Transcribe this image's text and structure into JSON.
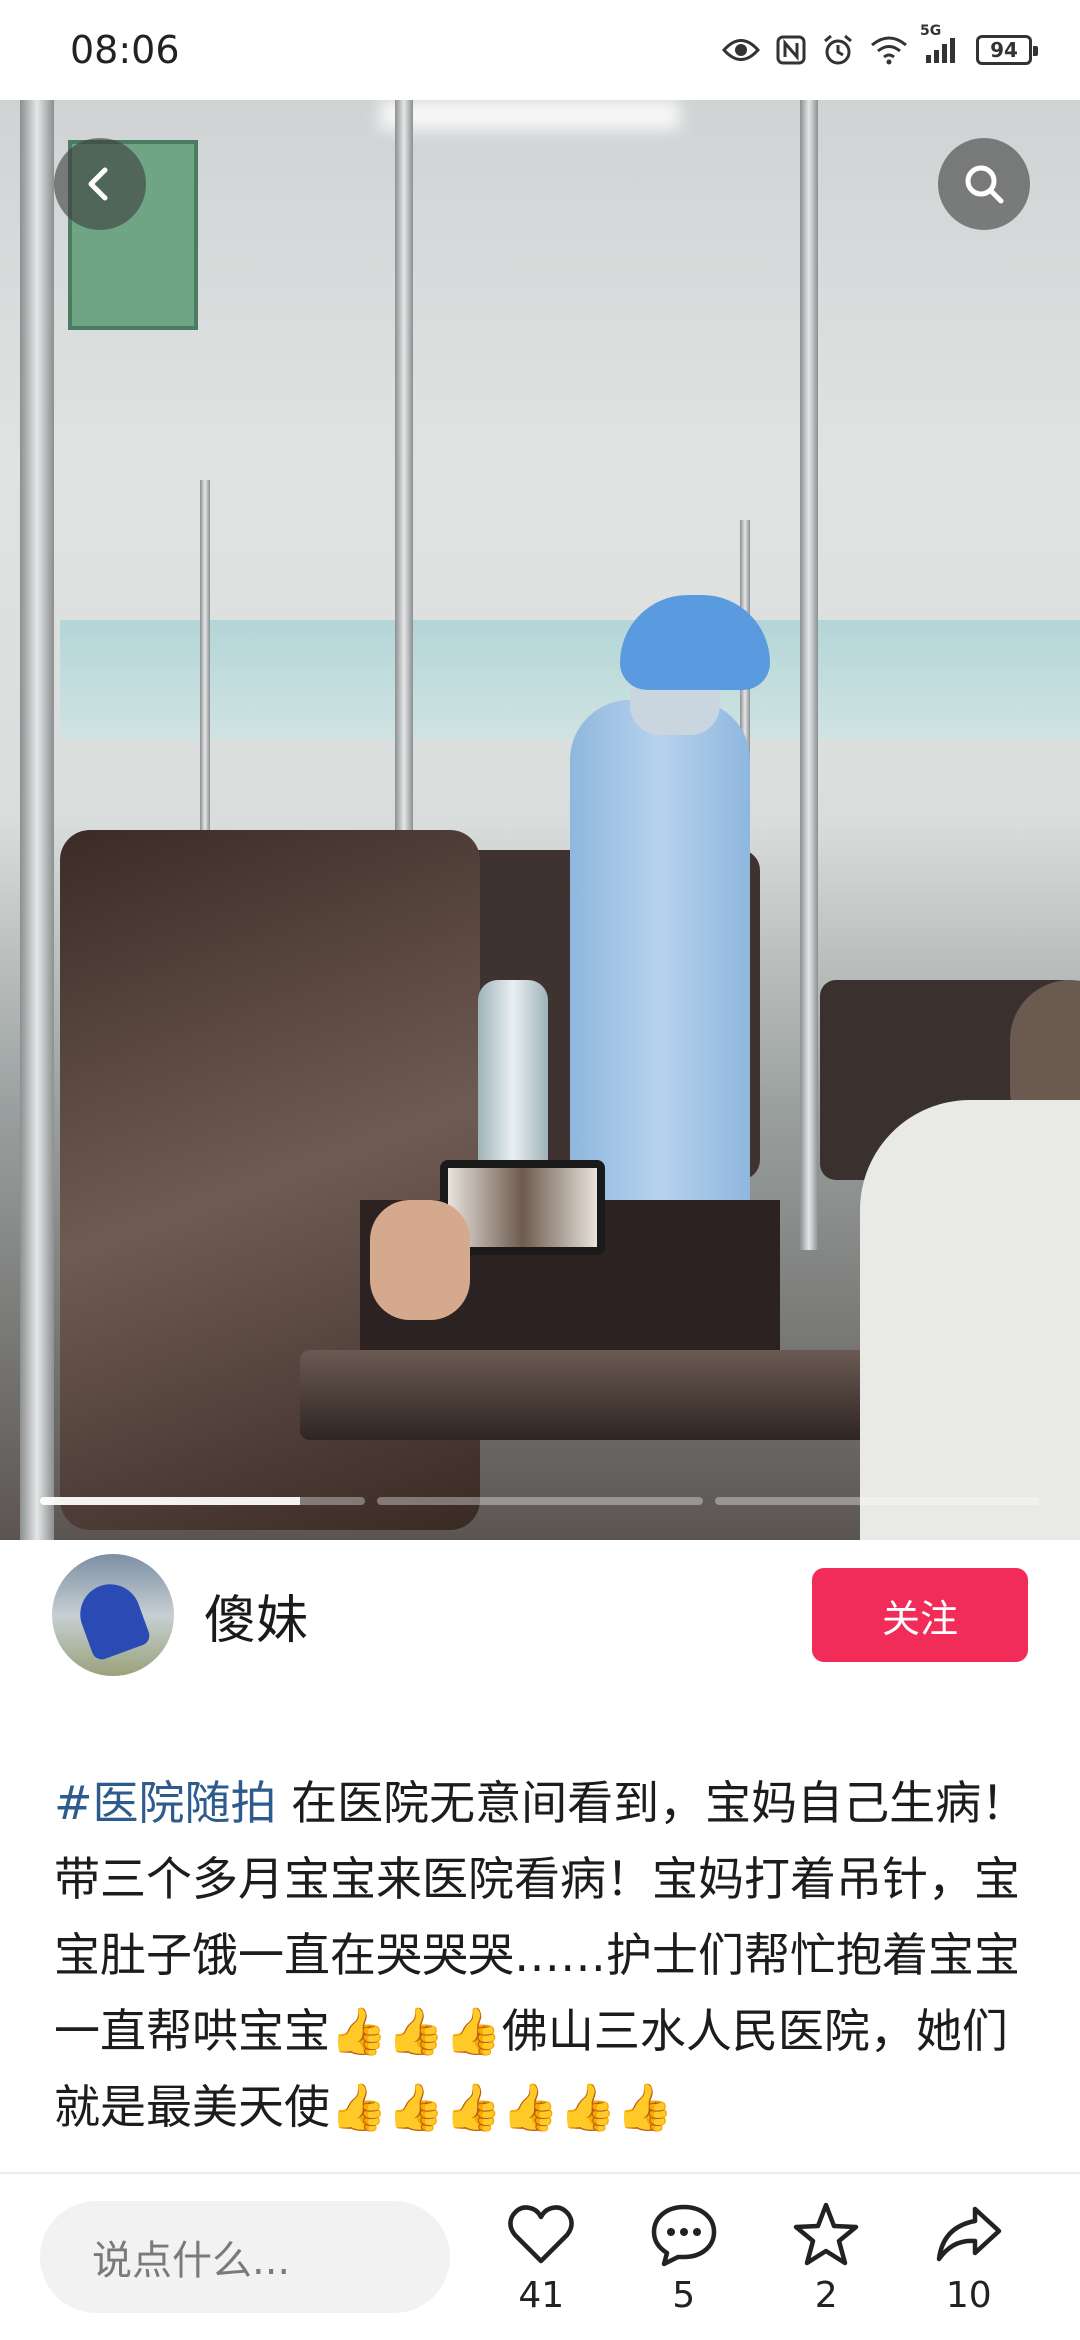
{
  "status_bar": {
    "time": "08:06",
    "icons": [
      "eye-icon",
      "nfc-icon",
      "alarm-icon",
      "wifi-icon",
      "signal-5g-icon"
    ],
    "network_label": "5G",
    "battery": "94"
  },
  "photo": {
    "progress_segments": [
      {
        "fill": 0.8
      },
      {
        "fill": 0
      },
      {
        "fill": 0
      }
    ]
  },
  "author": {
    "name": "傻妹",
    "follow_label": "关注"
  },
  "caption": {
    "hashtag": "#医院随拍",
    "text": " 在医院无意间看到，宝妈自己生病！带三个多月宝宝来医院看病！宝妈打着吊针，宝宝肚子饿一直在哭哭哭……护士们帮忙抱着宝宝一直帮哄宝宝👍👍👍佛山三水人民医院，她们就是最美天使👍👍👍👍👍👍"
  },
  "bottom_bar": {
    "comment_placeholder": "说点什么...",
    "likes": "41",
    "comments": "5",
    "favorites": "2",
    "shares": "10"
  }
}
